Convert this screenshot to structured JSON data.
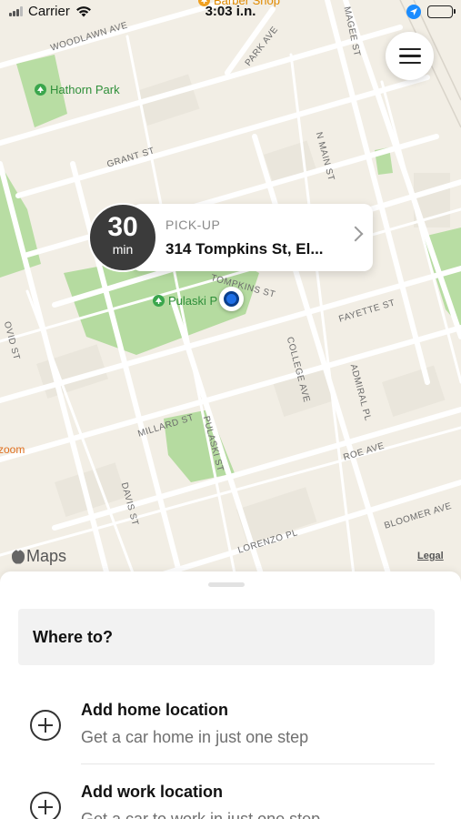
{
  "status_bar": {
    "carrier": "Carrier",
    "time": "3:03 i.n."
  },
  "map": {
    "streets": [
      "WOODLAWN AVE",
      "PARK AVE",
      "MAGEE ST",
      "N MAIN ST",
      "GRANT ST",
      "TOMPKINS ST",
      "FAYETTE ST",
      "COLLEGE AVE",
      "ADMIRAL PL",
      "OVID ST",
      "MILLARD ST",
      "PULASKI ST",
      "DAVIS ST",
      "ROE AVE",
      "BLOOMER AVE",
      "LORENZO PL"
    ],
    "pois": {
      "hathorn_park": "Hathorn Park",
      "pulaski_park": "Pulaski P",
      "barber_shop": "Barber Shop",
      "zoom": "zoom"
    },
    "attribution": "Maps",
    "legal": "Legal",
    "colors": {
      "land": "#f2eee5",
      "park": "#b5dba0",
      "road": "#ffffff",
      "pin": "#1f6fe6"
    }
  },
  "pickup": {
    "eta_value": "30",
    "eta_unit": "min",
    "label": "PICK-UP",
    "address": "314 Tompkins St, El..."
  },
  "sheet": {
    "search_placeholder": "Where to?",
    "shortcuts": [
      {
        "title": "Add home location",
        "subtitle": "Get a car home in just one step"
      },
      {
        "title": "Add work location",
        "subtitle": "Get a car to work in just one step"
      }
    ]
  }
}
